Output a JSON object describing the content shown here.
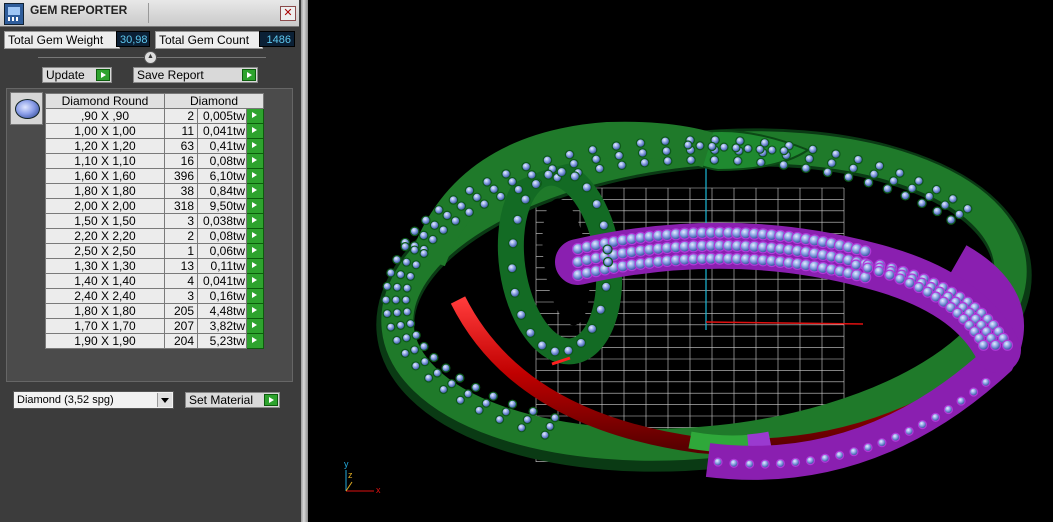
{
  "window": {
    "title": "GEM REPORTER",
    "close_glyph": "✕"
  },
  "stats": {
    "total_weight_label": "Total Gem Weight",
    "total_weight_value": "30,98",
    "total_count_label": "Total Gem Count",
    "total_count_value": "1486"
  },
  "actions": {
    "update_label": "Update",
    "save_report_label": "Save Report"
  },
  "table": {
    "columns": [
      "Diamond Round",
      "Diamond"
    ],
    "rows": [
      {
        "size": ",90 X ,90",
        "count": "2",
        "weight": "0,005tw"
      },
      {
        "size": "1,00 X 1,00",
        "count": "11",
        "weight": "0,041tw"
      },
      {
        "size": "1,20 X 1,20",
        "count": "63",
        "weight": "0,41tw"
      },
      {
        "size": "1,10 X 1,10",
        "count": "16",
        "weight": "0,08tw"
      },
      {
        "size": "1,60 X 1,60",
        "count": "396",
        "weight": "6,10tw"
      },
      {
        "size": "1,80 X 1,80",
        "count": "38",
        "weight": "0,84tw"
      },
      {
        "size": "2,00 X 2,00",
        "count": "318",
        "weight": "9,50tw"
      },
      {
        "size": "1,50 X 1,50",
        "count": "3",
        "weight": "0,038tw"
      },
      {
        "size": "2,20 X 2,20",
        "count": "2",
        "weight": "0,08tw"
      },
      {
        "size": "2,50 X 2,50",
        "count": "1",
        "weight": "0,06tw"
      },
      {
        "size": "1,30 X 1,30",
        "count": "13",
        "weight": "0,11tw"
      },
      {
        "size": "1,40 X 1,40",
        "count": "4",
        "weight": "0,041tw"
      },
      {
        "size": "2,40 X 2,40",
        "count": "3",
        "weight": "0,16tw"
      },
      {
        "size": "1,80 X 1,80",
        "count": "205",
        "weight": "4,48tw"
      },
      {
        "size": "1,70 X 1,70",
        "count": "207",
        "weight": "3,82tw"
      },
      {
        "size": "1,90 X 1,90",
        "count": "204",
        "weight": "5,23tw"
      }
    ]
  },
  "material": {
    "selected": "Diamond      (3,52 spg)",
    "set_label": "Set Material"
  },
  "viewport": {
    "axis_x": "x",
    "axis_y": "y",
    "axis_z": "z",
    "colors": {
      "green_metal": "#1f7a2a",
      "purple_metal": "#8a1fb0",
      "gem_blue": "#8fa6e6",
      "red_band": "#c00000",
      "grid": "#cfcfcf"
    }
  },
  "icons": [
    "app-icon",
    "close-icon",
    "go-arrow-icon",
    "gem-thumbnail-icon",
    "dropdown-arrow-icon",
    "axis-triad-icon"
  ]
}
